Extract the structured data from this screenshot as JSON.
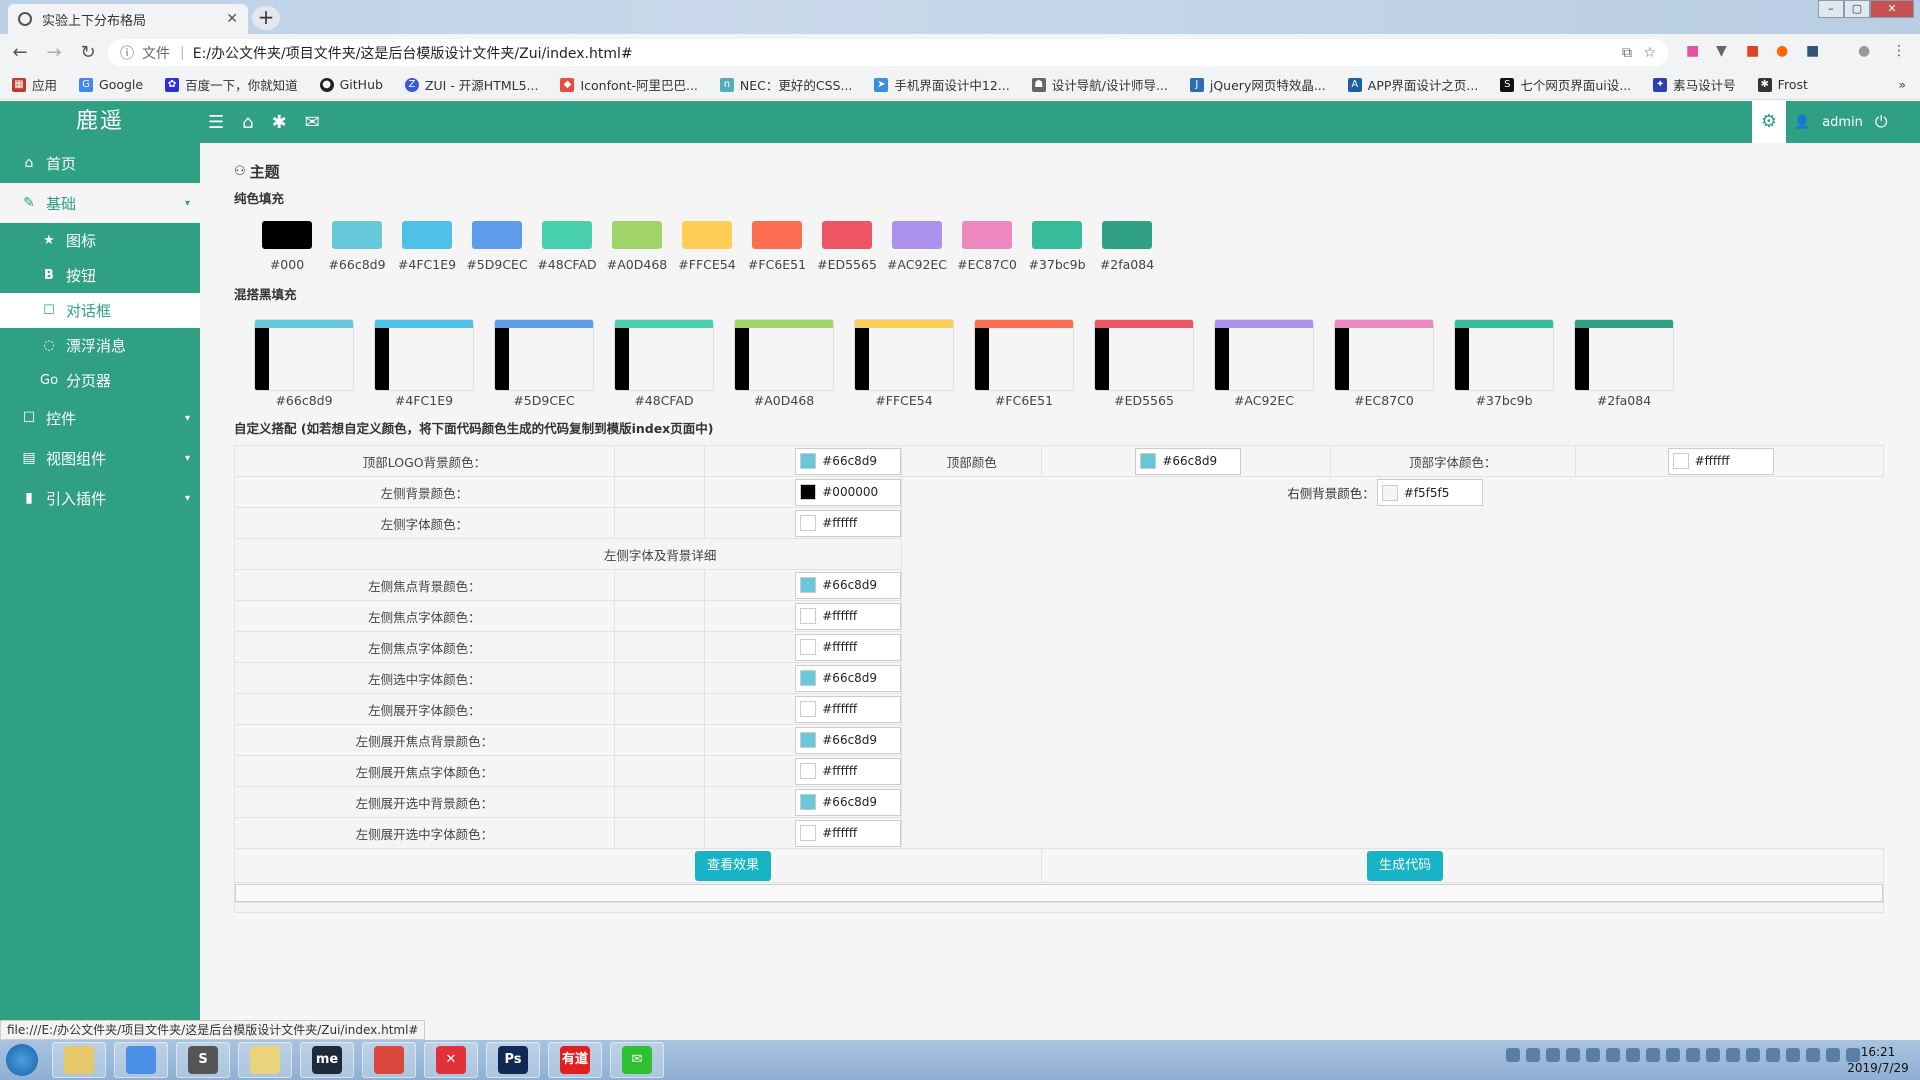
{
  "browser": {
    "tab_title": "实验上下分布格局",
    "address": "E:/办公文件夹/项目文件夹/这是后台模版设计文件夹/Zui/index.html#",
    "scheme_label": "文件",
    "bookmarks": [
      "应用",
      "Google",
      "百度一下，你就知道",
      "GitHub",
      "ZUI - 开源HTML5...",
      "Iconfont-阿里巴巴...",
      "NEC：更好的CSS...",
      "手机界面设计中12...",
      "设计导航/设计师导...",
      "jQuery网页特效晶...",
      "APP界面设计之页...",
      "七个网页界面ui设...",
      "素马设计号",
      "Frost"
    ]
  },
  "header": {
    "logo": "鹿遥",
    "user": "admin"
  },
  "sidebar": {
    "items": [
      {
        "label": "首页",
        "icon": "home-icon"
      },
      {
        "label": "基础",
        "icon": "edit-icon"
      },
      {
        "label": "控件",
        "icon": "checkbox-icon"
      },
      {
        "label": "视图组件",
        "icon": "table-icon"
      },
      {
        "label": "引入插件",
        "icon": "file-icon"
      }
    ],
    "sub": [
      {
        "label": "图标",
        "icon": "star-icon",
        "glyph": "★"
      },
      {
        "label": "按钮",
        "icon": "bold-icon",
        "glyph": "B"
      },
      {
        "label": "对话框",
        "icon": "square-icon",
        "glyph": "☐"
      },
      {
        "label": "漂浮消息",
        "icon": "chat-icon",
        "glyph": "◌"
      },
      {
        "label": "分页器",
        "icon": "go-icon",
        "glyph": "Go"
      }
    ]
  },
  "theme": {
    "title": "主题",
    "solid_title": "纯色填充",
    "mix_title": "混搭黑填充",
    "custom_title": "自定义搭配 (如若想自定义颜色，将下面代码颜色生成的代码复制到模版index页面中)",
    "solid": [
      "#000",
      "#66c8d9",
      "#4FC1E9",
      "#5D9CEC",
      "#48CFAD",
      "#A0D468",
      "#FFCE54",
      "#FC6E51",
      "#ED5565",
      "#AC92EC",
      "#EC87C0",
      "#37bc9b",
      "#2fa084"
    ],
    "mix": [
      "#66c8d9",
      "#4FC1E9",
      "#5D9CEC",
      "#48CFAD",
      "#A0D468",
      "#FFCE54",
      "#FC6E51",
      "#ED5565",
      "#AC92EC",
      "#EC87C0",
      "#37bc9b",
      "#2fa084"
    ]
  },
  "custom": {
    "logo_bg": {
      "label": "顶部LOGO背景颜色：",
      "value": "#66c8d9"
    },
    "top_color": {
      "label": "顶部颜色",
      "value": "#66c8d9"
    },
    "top_font": {
      "label": "顶部字体颜色：",
      "value": "#ffffff"
    },
    "left_bg": {
      "label": "左侧背景颜色：",
      "value": "#000000"
    },
    "right_bg": {
      "label": "右侧背景颜色：",
      "value": "#f5f5f5"
    },
    "left_font": {
      "label": "左侧字体颜色：",
      "value": "#ffffff"
    },
    "detail_title": "左侧字体及背景详细",
    "rows": [
      {
        "label": "左侧焦点背景颜色：",
        "value": "#66c8d9",
        "color": "#66c8d9"
      },
      {
        "label": "左侧焦点字体颜色：",
        "value": "#ffffff",
        "color": "#ffffff"
      },
      {
        "label": "左侧焦点字体颜色：",
        "value": "#ffffff",
        "color": "#ffffff"
      },
      {
        "label": "左侧选中字体颜色：",
        "value": "#66c8d9",
        "color": "#66c8d9"
      },
      {
        "label": "左侧展开字体颜色：",
        "value": "#ffffff",
        "color": "#ffffff"
      },
      {
        "label": "左侧展开焦点背景颜色：",
        "value": "#66c8d9",
        "color": "#66c8d9"
      },
      {
        "label": "左侧展开焦点字体颜色：",
        "value": "#ffffff",
        "color": "#ffffff"
      },
      {
        "label": "左侧展开选中背景颜色：",
        "value": "#66c8d9",
        "color": "#66c8d9"
      },
      {
        "label": "左侧展开选中字体颜色：",
        "value": "#ffffff",
        "color": "#ffffff"
      }
    ],
    "view_button": "查看效果",
    "gen_button": "生成代码"
  },
  "status_url": "file:///E:/办公文件夹/项目文件夹/这是后台模版设计文件夹/Zui/index.html#",
  "clock": {
    "time": "16:21",
    "date": "2019/7/29"
  },
  "taskbar_apps": [
    {
      "name": "explorer",
      "color": "#e8c96a",
      "text": ""
    },
    {
      "name": "chrome",
      "color": "#4a8ee6",
      "text": ""
    },
    {
      "name": "sublime",
      "color": "#555",
      "text": "S"
    },
    {
      "name": "folder",
      "color": "#e9d37c",
      "text": ""
    },
    {
      "name": "me",
      "color": "#1e2a3a",
      "text": "me"
    },
    {
      "name": "chrome2",
      "color": "#d9473c",
      "text": ""
    },
    {
      "name": "xmind",
      "color": "#e0303a",
      "text": "✕"
    },
    {
      "name": "photoshop",
      "color": "#0f2a55",
      "text": "Ps"
    },
    {
      "name": "youdao",
      "color": "#e02020",
      "text": "有道"
    },
    {
      "name": "wechat",
      "color": "#2ec02e",
      "text": "✉"
    }
  ]
}
